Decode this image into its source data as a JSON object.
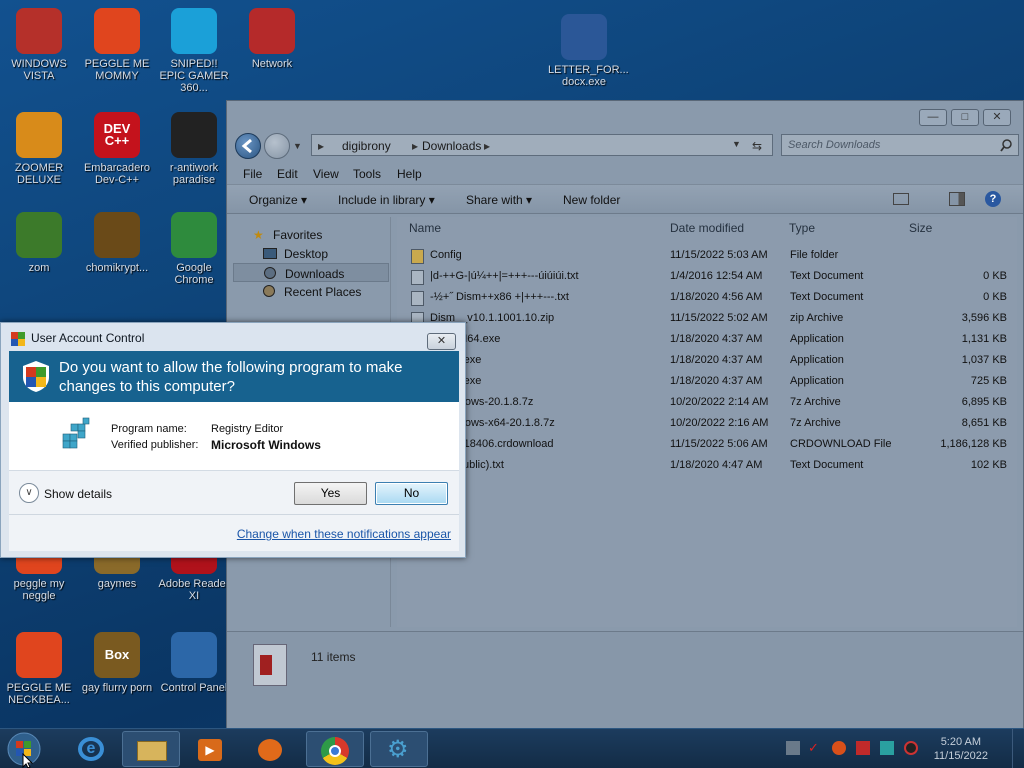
{
  "desktop_icons": [
    {
      "label": "WINDOWS VISTA",
      "icon": "sonic-icon",
      "color": "#b5302a"
    },
    {
      "label": "PEGGLE ME MOMMY",
      "icon": "peggle-icon",
      "color": "#e0451e"
    },
    {
      "label": "SNIPED!! EPIC GAMER 360...",
      "icon": "skype-icon",
      "color": "#1ba0d8"
    },
    {
      "label": "Network",
      "icon": "network-icon",
      "color": "#b52a2a"
    },
    {
      "label": "LETTER_FOR... docx.exe",
      "icon": "word-doc-icon",
      "color": "#2b5797"
    },
    {
      "label": "ZOOMER DELUXE",
      "icon": "zoomer-icon",
      "color": "#d88b1a"
    },
    {
      "label": "Embarcadero Dev-C++",
      "icon": "devcpp-icon",
      "color": "#c4121c",
      "glyph": "DEV C++"
    },
    {
      "label": "r-antiwork paradise",
      "icon": "reddit-icon",
      "color": "#222222"
    },
    {
      "label": "zom",
      "icon": "zombie-icon",
      "color": "#3c7a2a"
    },
    {
      "label": "chomikrypt...",
      "icon": "chomikrypt-icon",
      "color": "#6a4a18"
    },
    {
      "label": "Google Chrome",
      "icon": "chrome-icon",
      "color": "#2e8b3d"
    },
    {
      "label": "peggle my neggle",
      "icon": "peggle-icon",
      "color": "#e0451e"
    },
    {
      "label": "gaymes",
      "icon": "folder-icon",
      "color": "#8a6a2a"
    },
    {
      "label": "Adobe Reader XI",
      "icon": "adobe-reader-icon",
      "color": "#b0121b"
    },
    {
      "label": "PEGGLE ME NECKBEA...",
      "icon": "peggle-icon",
      "color": "#e0451e"
    },
    {
      "label": "gay flurry porn",
      "icon": "box-icon",
      "color": "#7a5a20",
      "glyph": "Box"
    },
    {
      "label": "Control Panel",
      "icon": "control-panel-icon",
      "color": "#2c67a8"
    }
  ],
  "explorer": {
    "breadcrumb": [
      "digibrony",
      "Downloads"
    ],
    "search_placeholder": "Search Downloads",
    "window_buttons": {
      "minimize": "—",
      "maximize": "□",
      "close": "✕"
    },
    "menu": [
      "File",
      "Edit",
      "View",
      "Tools",
      "Help"
    ],
    "commands": [
      "Organize ▾",
      "Include in library ▾",
      "Share with ▾",
      "New folder"
    ],
    "nav_items": [
      {
        "label": "Favorites",
        "icon": "star-icon"
      },
      {
        "label": "Desktop",
        "icon": "desktop-icon"
      },
      {
        "label": "Downloads",
        "icon": "downloads-icon",
        "selected": true
      },
      {
        "label": "Recent Places",
        "icon": "recent-places-icon"
      }
    ],
    "columns": [
      "Name",
      "Date modified",
      "Type",
      "Size"
    ],
    "files": [
      {
        "name": "Config",
        "date": "11/15/2022 5:03 AM",
        "type": "File folder",
        "size": ""
      },
      {
        "name": "|d-++G-|ú¼++|=+++---úiúiúi.txt",
        "date": "1/4/2016 12:54 AM",
        "type": "Text Document",
        "size": "0 KB"
      },
      {
        "name": "-½+˝ Dism++x86 +|+++---.txt",
        "date": "1/18/2020 4:56 AM",
        "type": "Text Document",
        "size": "0 KB"
      },
      {
        "name": "Dism__v10.1.1001.10.zip",
        "date": "11/15/2022 5:02 AM",
        "type": "zip Archive",
        "size": "3,596 KB"
      },
      {
        "name": "++ARM64.exe",
        "date": "1/18/2020 4:37 AM",
        "type": "Application",
        "size": "1,131 KB"
      },
      {
        "name": "++x64.exe",
        "date": "1/18/2020 4:37 AM",
        "type": "Application",
        "size": "1,037 KB"
      },
      {
        "name": "++x86.exe",
        "date": "1/18/2020 4:37 AM",
        "type": "Application",
        "size": "725 KB"
      },
      {
        "name": "orWindows-20.1.8.7z",
        "date": "10/20/2022 2:14 AM",
        "type": "7z Archive",
        "size": "6,895 KB"
      },
      {
        "name": "orWindows-x64-20.1.8.7z",
        "date": "10/20/2022 2:16 AM",
        "type": "7z Archive",
        "size": "8,651 KB"
      },
      {
        "name": "firmed 18406.crdownload",
        "date": "11/15/2022 5:06 AM",
        "type": "CRDOWNLOAD File",
        "size": "1,186,128 KB"
      },
      {
        "name": "New(Public).txt",
        "date": "1/18/2020 4:47 AM",
        "type": "Text Document",
        "size": "102 KB"
      }
    ],
    "status": "11 items"
  },
  "uac": {
    "title": "User Account Control",
    "close": "✕",
    "question": "Do you want to allow the following program to make changes to this computer?",
    "program_label": "Program name:",
    "program_value": "Registry Editor",
    "publisher_label": "Verified publisher:",
    "publisher_value": "Microsoft Windows",
    "show_details": "Show details",
    "yes": "Yes",
    "no": "No",
    "footer_link": "Change when these notifications appear"
  },
  "taskbar": {
    "apps": [
      {
        "name": "start-button",
        "icon": "windows-logo-icon"
      },
      {
        "name": "internet-explorer",
        "icon": "internet-explorer-icon"
      },
      {
        "name": "file-explorer",
        "icon": "file-explorer-icon"
      },
      {
        "name": "media-player",
        "icon": "media-player-icon"
      },
      {
        "name": "app-orange",
        "icon": "orange-app-icon"
      },
      {
        "name": "google-chrome",
        "icon": "chrome-icon"
      },
      {
        "name": "registry-editor",
        "icon": "gear-icon"
      }
    ],
    "time": "5:20 AM",
    "date": "11/15/2022"
  }
}
